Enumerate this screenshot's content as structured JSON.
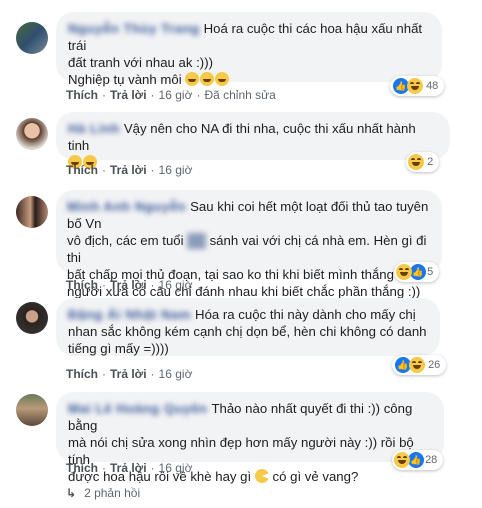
{
  "comments": [
    {
      "author": "Nguyễn Thùy Trang",
      "text_line1": "Hoá ra cuộc thi các hoa hậu xấu nhất trái",
      "text_line2": "đất tranh với nhau ak :)))",
      "text_line3": "Nghiệp tụ vành môi",
      "like": "Thích",
      "reply": "Trả lời",
      "time": "16 giờ",
      "edited": "Đã chỉnh sửa",
      "reaction_count": "48"
    },
    {
      "author": "Hà Linh",
      "text_line1": "Vậy nên cho NA đi thi nha, cuộc thi xấu nhất hành tinh",
      "like": "Thích",
      "reply": "Trả lời",
      "time": "16 giờ",
      "reaction_count": "2"
    },
    {
      "author": "Minh Anh Nguyễn",
      "text_line1": "Sau khi coi hết một loạt đối thủ tao tuyên bố Vn",
      "text_line2": "vô địch, các em tuổi",
      "text_line2b": "sánh vai với chị cá nhà em. Hèn gì đi thi",
      "text_line3": "bất chấp mọi thủ đoạn, tại sao ko thi khi biết mình thắng :))",
      "text_line4": "người xưa có câu chỉ đánh nhau khi biết chắc phần thắng :))",
      "like": "Thích",
      "reply": "Trả lời",
      "time": "16 giờ",
      "reaction_count": "5"
    },
    {
      "author": "Đặng Ái Nhật Nam",
      "text_line1": "Hóa ra cuộc thi này dành cho mấy chị",
      "text_line2": "nhan sắc không kém cạnh chị dọn bể, hèn chi không có danh",
      "text_line3": "tiếng gì mấy =))))",
      "like": "Thích",
      "reply": "Trả lời",
      "time": "16 giờ",
      "reaction_count": "26"
    },
    {
      "author": "Mai Lê Hoàng Quyên",
      "text_line1": "Thảo nào nhất quyết đi thi :)) công bằng",
      "text_line2": "mà nói chị sửa xong nhìn đẹp hơn mấy người này :)) rồi bộ tính",
      "text_line3": "được hoa hậu rồi về khè hay gì",
      "text_line3b": "có gì vẻ vang?",
      "like": "Thích",
      "reply": "Trả lời",
      "time": "16 giờ",
      "reaction_count": "28"
    }
  ],
  "replies_label": "2 phản hồi",
  "colors": {
    "link": "#385898",
    "bubble": "#f2f3f5",
    "meta": "#606770"
  }
}
